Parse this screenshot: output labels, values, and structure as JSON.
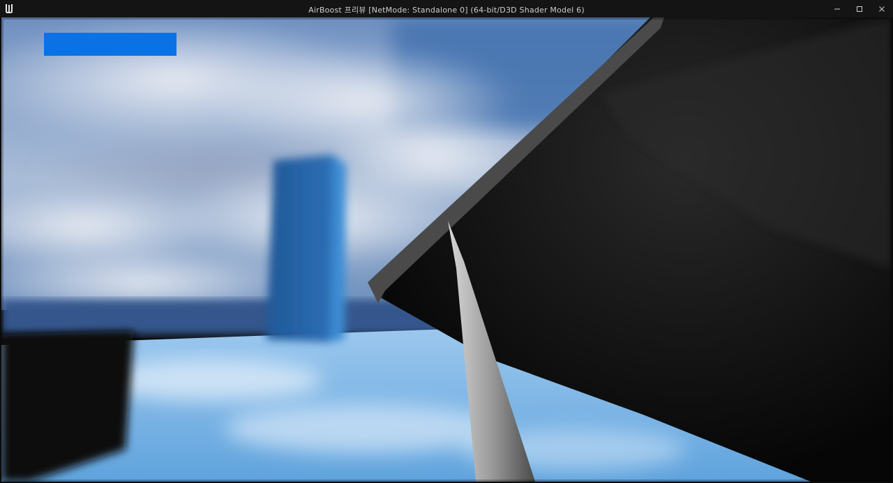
{
  "window": {
    "title": "AirBoost 프리뷰 [NetMode: Standalone 0]  (64-bit/D3D Shader Model 6)",
    "controls": [
      "minimize",
      "maximize",
      "close"
    ]
  },
  "hud": {
    "boost_bar_color": "#0b72e6",
    "boost_bar_fill": 1.0
  },
  "scene": {
    "sky_color": "#4a78b5",
    "cloud_color": "#e6e9f0",
    "floor_color": "#6fb1e6",
    "tower_color": "#2a64a8",
    "near_block_color": "#050608",
    "blade_color": "#9a9a9a"
  },
  "icons": {
    "logo": "unreal-engine-logo-icon",
    "minimize": "minimize-icon",
    "maximize": "maximize-icon",
    "close": "close-icon"
  }
}
